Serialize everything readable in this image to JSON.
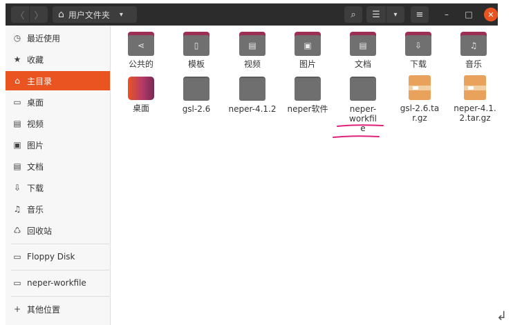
{
  "header": {
    "path_label": "用户文件夹",
    "nav_back_glyph": "〈",
    "nav_forward_glyph": "〉",
    "home_glyph": "⌂",
    "caret_glyph": "▾",
    "search_glyph": "⌕",
    "view_glyph": "☰",
    "menu_glyph": "≡",
    "minimize_glyph": "–",
    "maximize_glyph": "□",
    "close_glyph": "✕"
  },
  "sidebar": {
    "items": [
      {
        "label": "最近使用",
        "icon": "clock-icon",
        "glyph": "◷"
      },
      {
        "label": "收藏",
        "icon": "star-icon",
        "glyph": "★"
      },
      {
        "label": "主目录",
        "icon": "home-icon",
        "glyph": "⌂"
      },
      {
        "label": "桌面",
        "icon": "desktop-icon",
        "glyph": "▭"
      },
      {
        "label": "视频",
        "icon": "video-icon",
        "glyph": "▤"
      },
      {
        "label": "图片",
        "icon": "image-icon",
        "glyph": "▣"
      },
      {
        "label": "文档",
        "icon": "document-icon",
        "glyph": "▤"
      },
      {
        "label": "下载",
        "icon": "download-icon",
        "glyph": "⇩"
      },
      {
        "label": "音乐",
        "icon": "music-icon",
        "glyph": "♫"
      },
      {
        "label": "回收站",
        "icon": "trash-icon",
        "glyph": "♺"
      },
      {
        "label": "Floppy Disk",
        "icon": "drive-icon",
        "glyph": "▭"
      },
      {
        "label": "neper-workfile",
        "icon": "folder-icon",
        "glyph": "▭"
      },
      {
        "label": "其他位置",
        "icon": "plus-icon",
        "glyph": "+"
      }
    ]
  },
  "files": [
    {
      "name": "公共的",
      "kind": "share-folder",
      "glyph": "⋖"
    },
    {
      "name": "模板",
      "kind": "template-folder",
      "glyph": "▯"
    },
    {
      "name": "视频",
      "kind": "video-folder",
      "glyph": "▤"
    },
    {
      "name": "图片",
      "kind": "pictures-folder",
      "glyph": "▣"
    },
    {
      "name": "文档",
      "kind": "documents-folder",
      "glyph": "▤"
    },
    {
      "name": "下载",
      "kind": "downloads-folder",
      "glyph": "⇩"
    },
    {
      "name": "音乐",
      "kind": "music-folder",
      "glyph": "♫"
    },
    {
      "name": "桌面",
      "kind": "desktop"
    },
    {
      "name": "gsl-2.6",
      "kind": "folder"
    },
    {
      "name": "neper-4.1.2",
      "kind": "folder"
    },
    {
      "name": "neper软件",
      "kind": "folder"
    },
    {
      "name": "neper-workfile",
      "kind": "folder"
    },
    {
      "name": "gsl-2.6.tar.gz",
      "kind": "archive"
    },
    {
      "name": "neper-4.1.2.tar.gz",
      "kind": "archive"
    }
  ],
  "colors": {
    "accent": "#e95420",
    "headerbar": "#2c2c2c",
    "folder_tab": "#9d2e55",
    "folder_body": "#707070",
    "annotation": "#e0207a"
  },
  "corner_glyph": "↲"
}
